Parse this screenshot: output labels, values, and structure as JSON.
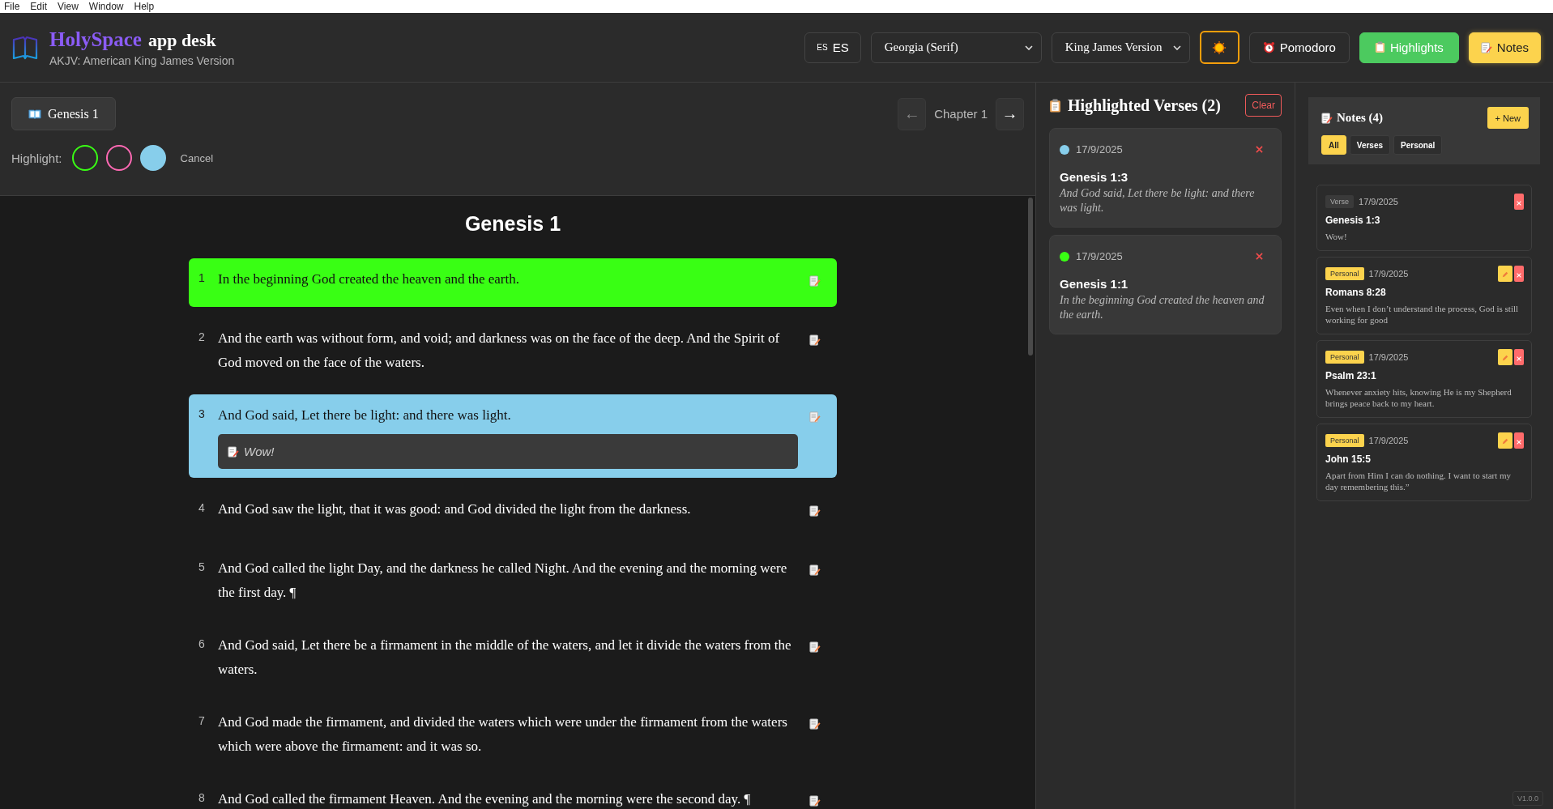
{
  "menu": [
    "File",
    "Edit",
    "View",
    "Window",
    "Help"
  ],
  "header": {
    "brand": "HolySpace",
    "brand_suffix": "app desk",
    "subtitle": "AKJV: American King James Version",
    "language": {
      "flag": "ES",
      "label": "ES"
    },
    "font_select": "Georgia (Serif)",
    "version_select": "King James Version",
    "pomodoro": "Pomodoro",
    "highlights_button": "Highlights",
    "notes_button": "Notes"
  },
  "reader": {
    "book_button": "Genesis 1",
    "prev": "←",
    "chapter": "Chapter 1",
    "next": "→",
    "highlight_label": "Highlight:",
    "highlight_colors": [
      {
        "color": "#39ff14",
        "selected": false
      },
      {
        "color": "#ff69b4",
        "selected": false
      },
      {
        "color": "#87ceeb",
        "selected": true
      }
    ],
    "cancel": "Cancel",
    "title": "Genesis 1",
    "verses": [
      {
        "number": "1",
        "text": "In the beginning God created the heaven and the earth.",
        "color": "#39ff14"
      },
      {
        "number": "2",
        "text": "And the earth was without form, and void; and darkness was on the face of the deep. And the Spirit of God moved on the face of the waters."
      },
      {
        "number": "3",
        "text": "And God said, Let there be light: and there was light.",
        "color": "#87ceeb",
        "note": "Wow!"
      },
      {
        "number": "4",
        "text": "And God saw the light, that it was good: and God divided the light from the darkness."
      },
      {
        "number": "5",
        "text": "And God called the light Day, and the darkness he called Night. And the evening and the morning were the first day. ¶"
      },
      {
        "number": "6",
        "text": "And God said, Let there be a firmament in the middle of the waters, and let it divide the waters from the waters."
      },
      {
        "number": "7",
        "text": "And God made the firmament, and divided the waters which were under the firmament from the waters which were above the firmament: and it was so."
      },
      {
        "number": "8",
        "text": "And God called the firmament Heaven. And the evening and the morning were the second day. ¶"
      }
    ]
  },
  "highlights": {
    "title": "Highlighted Verses (2)",
    "clear": "Clear",
    "items": [
      {
        "color": "#87ceeb",
        "date": "17/9/2025",
        "reference": "Genesis 1:3",
        "text": "And God said, Let there be light: and there was light."
      },
      {
        "color": "#39ff14",
        "date": "17/9/2025",
        "reference": "Genesis 1:1",
        "text": "In the beginning God created the heaven and the earth."
      }
    ]
  },
  "notes": {
    "title": "Notes (4)",
    "new": "+ New",
    "filters": [
      {
        "label": "All",
        "selected": true
      },
      {
        "label": "Verses",
        "selected": false
      },
      {
        "label": "Personal",
        "selected": false
      }
    ],
    "items": [
      {
        "kind": "verse",
        "tag": "Verse",
        "date": "17/9/2025",
        "reference": "Genesis 1:3",
        "text": "Wow!",
        "editable": false
      },
      {
        "kind": "personal",
        "tag": "Personal",
        "date": "17/9/2025",
        "reference": "Romans 8:28",
        "text": "Even when I don’t understand the process, God is still working for good",
        "editable": true
      },
      {
        "kind": "personal",
        "tag": "Personal",
        "date": "17/9/2025",
        "reference": "Psalm 23:1",
        "text": "Whenever anxiety hits, knowing He is my Shepherd brings peace back to my heart.",
        "editable": true
      },
      {
        "kind": "personal",
        "tag": "Personal",
        "date": "17/9/2025",
        "reference": "John 15:5",
        "text": "Apart from Him I can do nothing. I want to start my day remembering this.”",
        "editable": true
      }
    ]
  },
  "app_version": "V1.0.0"
}
